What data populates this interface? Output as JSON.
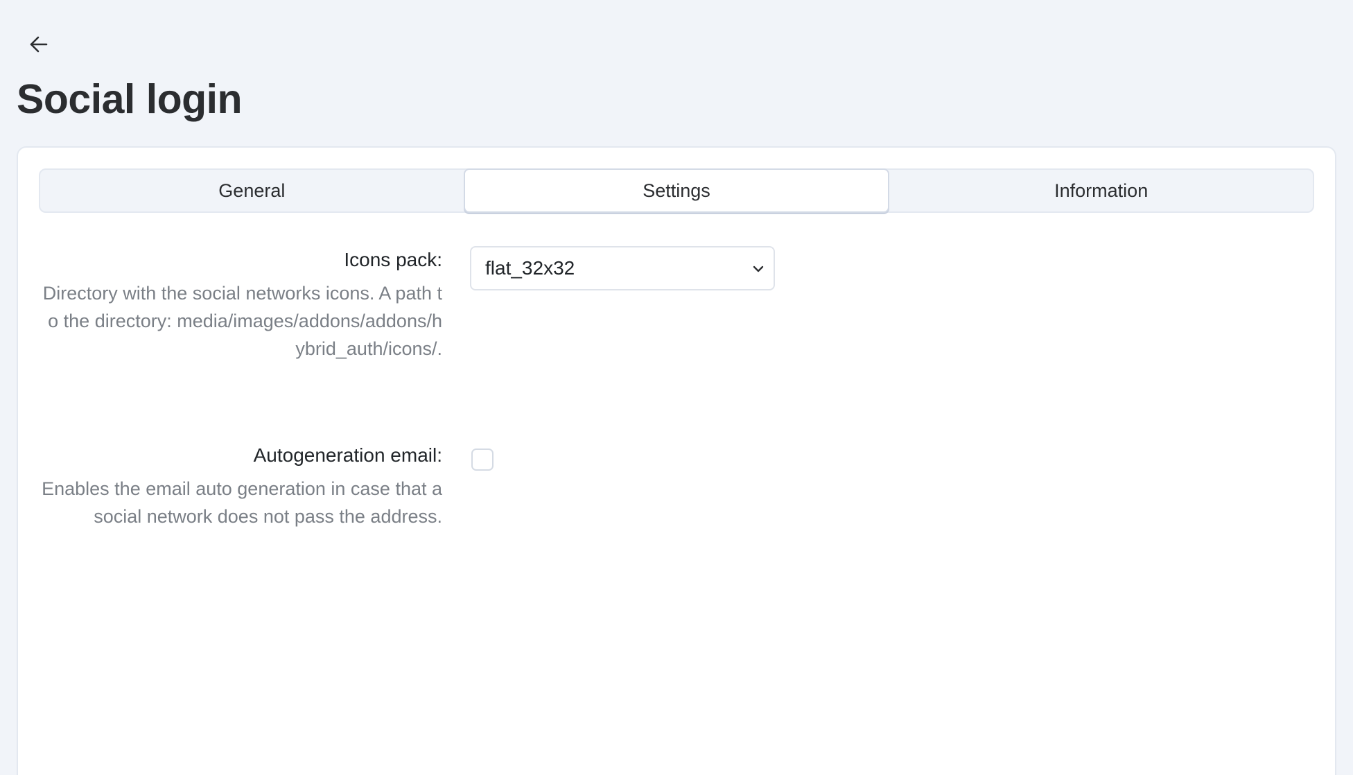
{
  "header": {
    "back_icon": "arrow-left-icon",
    "title": "Social login"
  },
  "tabs": [
    {
      "label": "General",
      "active": false
    },
    {
      "label": "Settings",
      "active": true
    },
    {
      "label": "Information",
      "active": false
    }
  ],
  "settings": {
    "icons_pack": {
      "label": "Icons pack:",
      "help": "Directory with the social networks icons. A path to the directory: media/images/addons/addons/hybrid_auth/icons/.",
      "selected_value": "flat_32x32",
      "icon": "chevron-down-icon"
    },
    "autogeneration_email": {
      "label": "Autogeneration email:",
      "help": "Enables the email auto generation in case that a social network does not pass the address.",
      "checked": false
    }
  },
  "colors": {
    "page_background": "#f1f4f9",
    "card_background": "#ffffff",
    "border": "#e3e8f0",
    "help_text": "#7a7f86",
    "title_text": "#2b2d30"
  }
}
